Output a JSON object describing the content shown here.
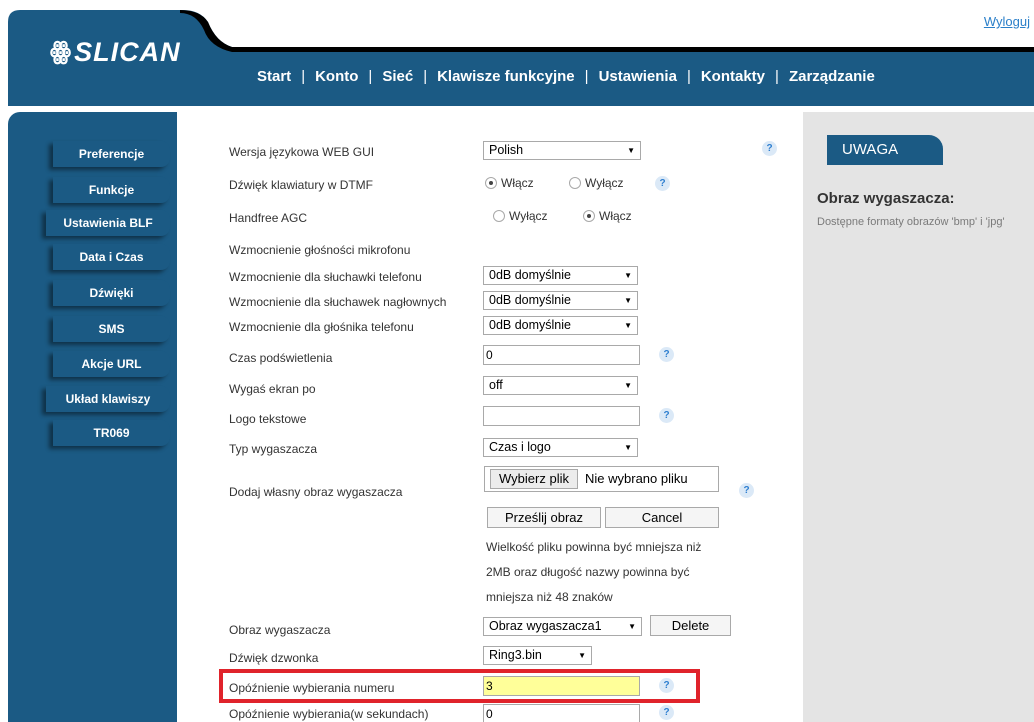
{
  "header": {
    "logout": "Wyloguj",
    "logo_mark": "ꙮ",
    "logo_text": "SLICAN",
    "nav": [
      "Start",
      "Konto",
      "Sieć",
      "Klawisze funkcyjne",
      "Ustawienia",
      "Kontakty",
      "Zarządzanie"
    ],
    "active_nav": "Ustawienia"
  },
  "sidebar": {
    "items": [
      "Preferencje",
      "Funkcje",
      "Ustawienia BLF",
      "Data i Czas",
      "Dźwięki",
      "SMS",
      "Akcje URL",
      "Układ klawiszy",
      "TR069"
    ]
  },
  "form": {
    "language": {
      "label": "Wersja językowa WEB GUI",
      "value": "Polish"
    },
    "dtmf": {
      "label": "Dźwięk klawiatury w DTMF",
      "on": "Włącz",
      "off": "Wyłącz",
      "selected": "Włącz"
    },
    "agc": {
      "label": "Handfree AGC",
      "off": "Wyłącz",
      "on": "Włącz",
      "selected": "Włącz"
    },
    "mic_header": "Wzmocnienie głośności mikrofonu",
    "gain_handset": {
      "label": "Wzmocnienie dla słuchawki telefonu",
      "value": "0dB domyślnie"
    },
    "gain_headset": {
      "label": "Wzmocnienie dla słuchawek nagłownych",
      "value": "0dB domyślnie"
    },
    "gain_speaker": {
      "label": "Wzmocnienie dla głośnika telefonu",
      "value": "0dB domyślnie"
    },
    "backlight": {
      "label": "Czas podświetlenia",
      "value": "0"
    },
    "screen_off": {
      "label": "Wygaś ekran po",
      "value": "off"
    },
    "logo_text": {
      "label": "Logo tekstowe",
      "value": ""
    },
    "saver_type": {
      "label": "Typ wygaszacza",
      "value": "Czas i logo"
    },
    "upload": {
      "label": "Dodaj własny obraz wygaszacza",
      "choose": "Wybierz plik",
      "no_file": "Nie wybrano pliku",
      "send": "Prześlij obraz",
      "cancel": "Cancel",
      "info": [
        "Wielkość pliku powinna być mniejsza niż",
        "2MB oraz długość nazwy powinna być",
        "mniejsza niż 48 znaków"
      ]
    },
    "saver_image": {
      "label": "Obraz wygaszacza",
      "value": "Obraz wygaszacza1",
      "delete": "Delete"
    },
    "ringtone": {
      "label": "Dźwięk dzwonka",
      "value": "Ring3.bin"
    },
    "dial_delay": {
      "label": "Opóźnienie wybierania numeru",
      "value": "3"
    },
    "dial_delay_sec": {
      "label": "Opóźnienie wybierania(w sekundach)",
      "value": "0"
    }
  },
  "notes": {
    "tab": "UWAGA",
    "title": "Obraz wygaszacza:",
    "text": "Dostępne formaty obrazów 'bmp' i 'jpg'"
  },
  "help_glyph": "?",
  "select_arrow": "▼",
  "colors": {
    "brand": "#1b5a84",
    "highlight_border": "#e0232b",
    "input_highlight": "#ffff99"
  }
}
